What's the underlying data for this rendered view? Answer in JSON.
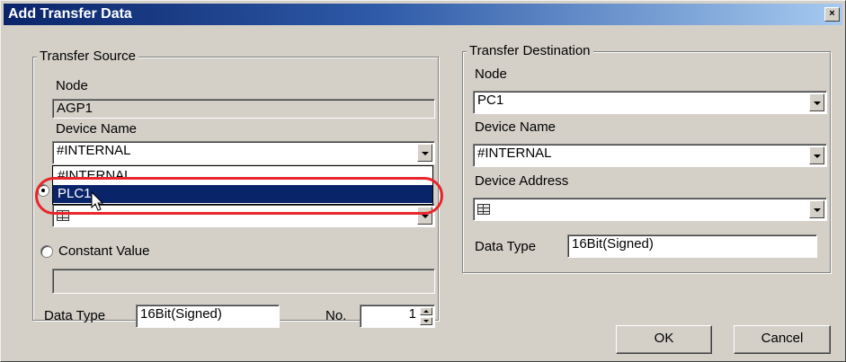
{
  "window": {
    "title": "Add Transfer Data",
    "close_glyph": "×"
  },
  "source": {
    "group_title": "Transfer Source",
    "node_label": "Node",
    "node_value": "AGP1",
    "device_name_label": "Device Name",
    "device_name_value": "#INTERNAL",
    "dropdown_options": [
      "#INTERNAL",
      "PLC1"
    ],
    "constant_value_label": "Constant Value",
    "constant_value": "",
    "data_type_label": "Data Type",
    "data_type_value": "16Bit(Signed)",
    "no_label": "No.",
    "no_value": "1"
  },
  "destination": {
    "group_title": "Transfer Destination",
    "node_label": "Node",
    "node_value": "PC1",
    "device_name_label": "Device Name",
    "device_name_value": "#INTERNAL",
    "device_address_label": "Device Address",
    "device_address_value": "",
    "data_type_label": "Data Type",
    "data_type_value": "16Bit(Signed)"
  },
  "buttons": {
    "ok": "OK",
    "cancel": "Cancel"
  },
  "colors": {
    "title_start": "#0a246a",
    "title_end": "#a6caf0",
    "selection": "#0a246a",
    "highlight": "#e8262c",
    "face": "#d4d0c8"
  }
}
